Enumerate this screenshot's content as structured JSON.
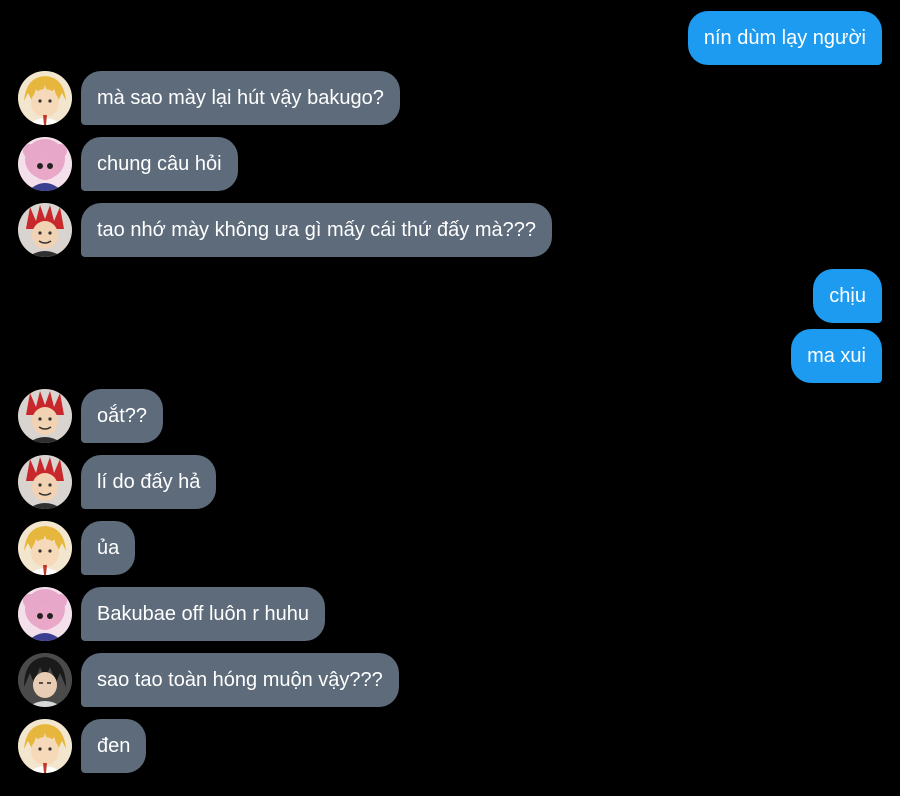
{
  "colors": {
    "background": "#000000",
    "outgoing_bubble": "#1d9bf0",
    "incoming_bubble": "#5d6b7b",
    "text": "#ffffff"
  },
  "avatars": {
    "denki": {
      "name": "blonde-anime-avatar-icon",
      "hair": "#e7b63c",
      "bg": "#f2e6cf",
      "accent": "#c0392b"
    },
    "mina": {
      "name": "pink-anime-avatar-icon",
      "hair": "#e7a7c9",
      "bg": "#f3e0ea",
      "accent": "#3b3f8f"
    },
    "kirishima": {
      "name": "redhead-anime-avatar-icon",
      "hair": "#c8282c",
      "bg": "#d9d4cf",
      "accent": "#2f2f2f"
    },
    "sero": {
      "name": "dark-hair-anime-avatar-icon",
      "hair": "#1a1a1a",
      "bg": "#4a4a4a",
      "accent": "#d8d8d8"
    }
  },
  "messages": [
    {
      "direction": "out",
      "text": "nín dùm lạy người"
    },
    {
      "direction": "in",
      "avatar": "denki",
      "text": "mà sao mày lại hút vậy bakugo?"
    },
    {
      "direction": "in",
      "avatar": "mina",
      "text": "chung câu hỏi"
    },
    {
      "direction": "in",
      "avatar": "kirishima",
      "text": "tao nhớ mày không ưa gì mấy cái thứ đấy mà???"
    },
    {
      "direction": "out",
      "text": "chịu"
    },
    {
      "direction": "out",
      "text": "ma xui"
    },
    {
      "direction": "in",
      "avatar": "kirishima",
      "text": "oắt??"
    },
    {
      "direction": "in",
      "avatar": "kirishima",
      "text": "lí do đấy hả"
    },
    {
      "direction": "in",
      "avatar": "denki",
      "text": "ủa"
    },
    {
      "direction": "in",
      "avatar": "mina",
      "text": "Bakubae off luôn r huhu"
    },
    {
      "direction": "in",
      "avatar": "sero",
      "text": "sao tao toàn hóng muộn vậy???"
    },
    {
      "direction": "in",
      "avatar": "denki",
      "text": "đen"
    }
  ]
}
